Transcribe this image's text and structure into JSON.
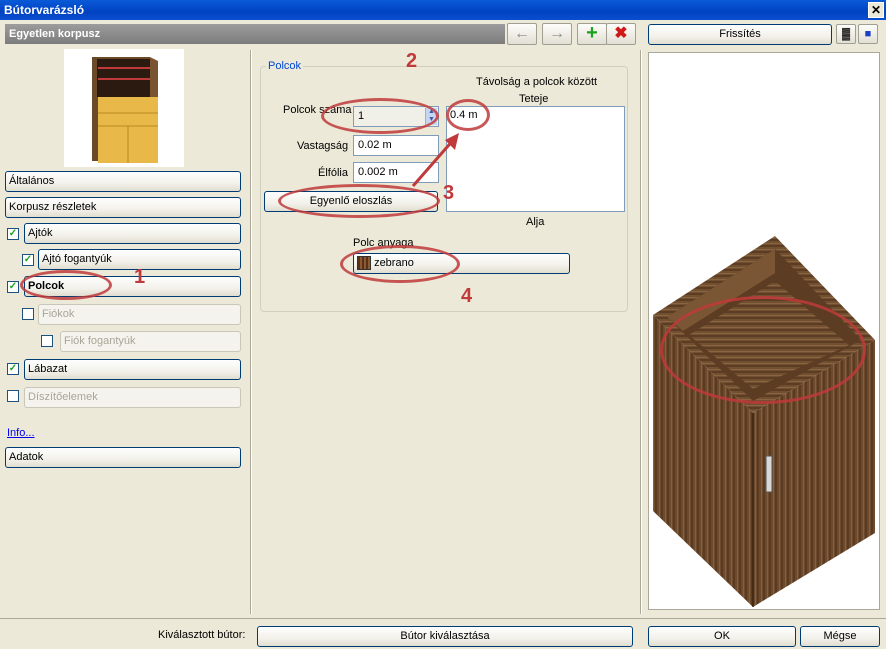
{
  "window": {
    "title": "Bútorvarázsló",
    "close_label": "✕"
  },
  "header": {
    "title": "Egyetlen korpusz"
  },
  "toolbar": {
    "back_icon": "arrow-left-icon",
    "forward_icon": "arrow-right-icon",
    "add_icon": "plus-icon",
    "delete_icon": "x-icon",
    "refresh_label": "Frissítés"
  },
  "sidebar": {
    "items": [
      {
        "label": "Általános"
      },
      {
        "label": "Korpusz részletek"
      },
      {
        "label": "Ajtók",
        "checked": true
      },
      {
        "label": "Ajtó fogantyúk",
        "checked": true
      },
      {
        "label": "Polcok",
        "checked": true
      },
      {
        "label": "Fiókok",
        "checked": false
      },
      {
        "label": "Fiók fogantyúk",
        "checked": false
      },
      {
        "label": "Lábazat",
        "checked": true
      },
      {
        "label": "Díszítőelemek",
        "checked": false
      }
    ],
    "info_link": "Info...",
    "data_button": "Adatok"
  },
  "shelves": {
    "group_title": "Polcok",
    "count_label": "Polcok száma",
    "count_value": "1",
    "thickness_label": "Vastagság",
    "thickness_value": "0.02 m",
    "edge_label": "Élfólia",
    "edge_value": "0.002 m",
    "distribute_button": "Egyenlő eloszlás",
    "distance_title": "Távolság a polcok között",
    "top_label": "Teteje",
    "bottom_label": "Alja",
    "distance_value": "0.4 m",
    "material_label": "Polc anyaga",
    "material_value": "zebrano"
  },
  "annotations": {
    "n1": "1",
    "n2": "2",
    "n3": "3",
    "n4": "4"
  },
  "footer": {
    "selected_label": "Kiválasztott bútor:",
    "select_button": "Bútor kiválasztása",
    "ok_button": "OK",
    "cancel_button": "Mégse"
  }
}
